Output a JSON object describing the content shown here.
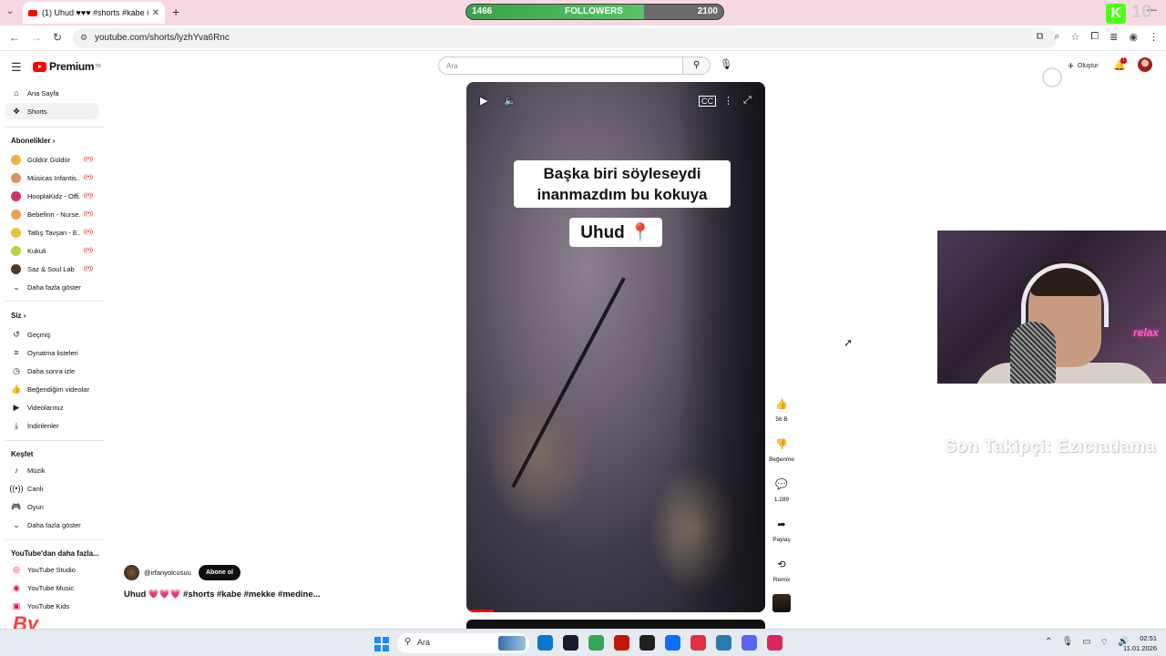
{
  "browser": {
    "tab_title": "(1) Uhud ♥♥♥ #shorts #kabe #",
    "url": "youtube.com/shorts/lyzhYva6Rnc"
  },
  "overlay": {
    "followers_current": "1466",
    "followers_label": "FOLLOWERS",
    "followers_goal": "2100",
    "followers_progress": 0.69,
    "kick_number": "10",
    "last_follower": "Son Takipçi: Ezıcıadama",
    "neon_sign": "relax",
    "corner_logo": "By"
  },
  "masthead": {
    "logo_text": "Premium",
    "logo_region": "TR",
    "search_placeholder": "Ara",
    "create_label": "Oluştur",
    "notification_count": "1"
  },
  "sidebar": {
    "home": "Ana Sayfa",
    "shorts": "Shorts",
    "subscriptions_heading": "Abonelikler",
    "subscriptions": [
      {
        "name": "Güldür Güldür",
        "color": "#f0b040"
      },
      {
        "name": "Músicas Infantis...",
        "color": "#e09060"
      },
      {
        "name": "HooplaKidz - Offi...",
        "color": "#d03070"
      },
      {
        "name": "Bebefinn - Nurse...",
        "color": "#f0a050"
      },
      {
        "name": "Tatlış Tavşan - E...",
        "color": "#f0c030"
      },
      {
        "name": "Kukuli",
        "color": "#c0d040"
      },
      {
        "name": "Saz & Soul Lab",
        "color": "#503828"
      }
    ],
    "show_more_subs": "Daha fazla göster",
    "you_heading": "Siz",
    "you_items": [
      "Geçmiş",
      "Oynatma listeleri",
      "Daha sonra izle",
      "Beğendiğim videolar",
      "Videolarınız",
      "İndirilenler"
    ],
    "explore_heading": "Keşfet",
    "explore_items": [
      "Müzik",
      "Canlı",
      "Oyun"
    ],
    "show_more_explore": "Daha fazla göster",
    "more_heading": "YouTube'dan daha fazla...",
    "more_items": [
      "YouTube Studio",
      "YouTube Music",
      "YouTube Kids"
    ]
  },
  "video": {
    "caption_line1": "Başka biri söyleseydi",
    "caption_line2": "inanmazdım bu kokuya",
    "caption_place": "Uhud 📍",
    "progress": 0.09,
    "channel": "@irfanyolcusuu",
    "subscribe_label": "Abone ol",
    "title": "Uhud 💗💗💗 #shorts #kabe #mekke #medine..."
  },
  "actions": {
    "likes": "56 B",
    "dislike": "Beğenme",
    "comments": "1.289",
    "share": "Paylaş",
    "remix": "Remix"
  },
  "taskbar": {
    "search_label": "Ara",
    "time": "02:51",
    "date": "11.01.2026",
    "icon_colors": [
      "#0b78d0",
      "#1a1a2e",
      "#34a853",
      "#c21807",
      "#202020",
      "#0d6efd",
      "#e03040",
      "#2a7ab0",
      "#5865f2",
      "#e0245e"
    ]
  }
}
